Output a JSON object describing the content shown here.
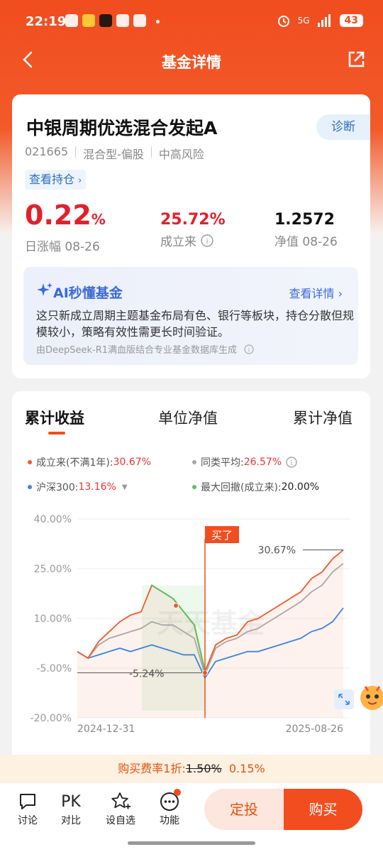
{
  "status": {
    "time": "22:19",
    "battery": "43",
    "network": "5G"
  },
  "nav": {
    "title": "基金详情"
  },
  "fund": {
    "name": "中银周期优选混合发起A",
    "diagnose": "诊断",
    "code": "021665",
    "type": "混合型-偏股",
    "risk": "中高风险",
    "holdings": "查看持仓",
    "day_change": "0.22",
    "day_change_unit": "%",
    "day_change_label": "日涨幅 08-26",
    "since_inception": "25.72%",
    "since_inception_label": "成立来",
    "nav": "1.2572",
    "nav_label": "净值 08-26"
  },
  "ai": {
    "title": "AI秒懂基金",
    "detail": "查看详情",
    "text": "这只新成立周期主题基金布局有色、银行等板块，持仓分散但规模较小，策略有效性需更长时间验证。",
    "footer": "由DeepSeek-R1满血版结合专业基金数据库生成"
  },
  "tabs": [
    "累计收益",
    "单位净值",
    "累计净值"
  ],
  "legend": {
    "fund_label": "成立来(不满1年):",
    "fund_value": "30.67%",
    "avg_label": "同类平均:",
    "avg_value": "26.57%",
    "hs300_label": "沪深300:",
    "hs300_value": "13.16%",
    "dd_label": "最大回撤(成立来):",
    "dd_value": "20.00%"
  },
  "colors": {
    "fund": "#f15a29",
    "avg": "#a8a8a8",
    "hs300": "#3a86e0",
    "dd": "#5cc05c",
    "accent": "#f14d1f"
  },
  "chart_data": {
    "type": "line",
    "ylim": [
      -20,
      40
    ],
    "yticks": [
      "40.00%",
      "25.00%",
      "10.00%",
      "-5.00%",
      "-20.00%"
    ],
    "x_start": "2024-12-31",
    "x_end": "2025-08-26",
    "series": [
      {
        "name": "成立来(不满1年)",
        "values": [
          0,
          -2,
          3,
          6,
          9,
          11,
          12,
          20,
          18,
          16,
          12,
          8,
          -6,
          2,
          4,
          5,
          9,
          10,
          12,
          14,
          16,
          18,
          22,
          24,
          28,
          30.67
        ]
      },
      {
        "name": "同类平均",
        "values": [
          0,
          -2,
          2,
          4,
          5,
          6,
          7,
          9,
          8,
          8,
          6,
          4,
          -7,
          1,
          3,
          4,
          6,
          7,
          9,
          11,
          13,
          15,
          18,
          20,
          24,
          26.57
        ]
      },
      {
        "name": "沪深300",
        "values": [
          0,
          -2,
          -1,
          0,
          1,
          0,
          1,
          2,
          1,
          0,
          -1,
          -1,
          -8,
          -3,
          -2,
          -1,
          0,
          0,
          1,
          2,
          3,
          4,
          6,
          7,
          9,
          13.16
        ]
      }
    ],
    "annotations": {
      "max": "30.67%",
      "drawdown_low": "-5.24%",
      "buy_marker": "买了",
      "watermark": "天天基金"
    }
  },
  "fee": {
    "prefix": "购买费率1折:",
    "old": "1.50%",
    "new": "0.15%"
  },
  "bottom": {
    "discuss": "讨论",
    "pk_icon": "PK",
    "compare": "对比",
    "watchlist": "设自选",
    "features": "功能",
    "dingtou": "定投",
    "buy": "购买"
  }
}
